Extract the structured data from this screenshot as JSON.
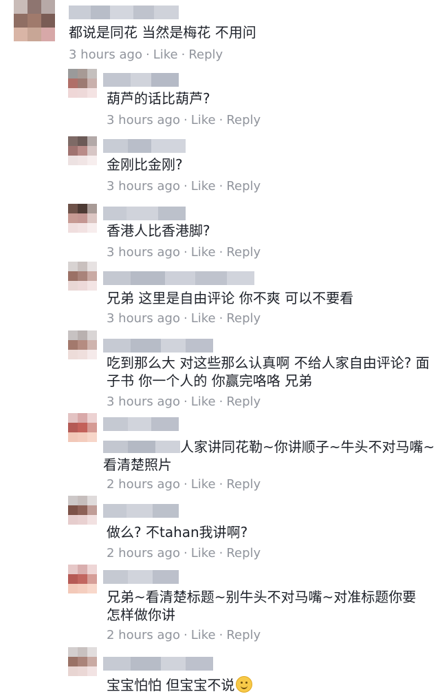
{
  "comments": [
    {
      "text": "都说是同花 当然是梅花 不用问",
      "time": "3 hours ago",
      "like": "Like",
      "reply": "Reply"
    },
    {
      "text": "葫芦的话比葫芦?",
      "time": "3 hours ago",
      "like": "Like",
      "reply": "Reply"
    },
    {
      "text": "金刚比金刚?",
      "time": "3 hours ago",
      "like": "Like",
      "reply": "Reply"
    },
    {
      "text": "香港人比香港脚?",
      "time": "3 hours ago",
      "like": "Like",
      "reply": "Reply"
    },
    {
      "text": "兄弟 这里是自由评论 你不爽 可以不要看",
      "time": "3 hours ago",
      "like": "Like",
      "reply": "Reply"
    },
    {
      "text": "吃到那么大 对这些那么认真啊 不给人家自由评论? 面子书 你一个人的 你赢完咯咯 兄弟",
      "time": "3 hours ago",
      "like": "Like",
      "reply": "Reply"
    },
    {
      "text": "人家讲同花勒~你讲顺子~牛头不对马嘴~看清楚照片",
      "time": "2 hours ago",
      "like": "Like",
      "reply": "Reply"
    },
    {
      "text": "做么? 不tahan我讲啊?",
      "time": "2 hours ago",
      "like": "Like",
      "reply": "Reply"
    },
    {
      "text": "兄弟~看清楚标题~别牛头不对马嘴~对准标题你要怎样做你讲",
      "time": "2 hours ago",
      "like": "Like",
      "reply": "Reply"
    },
    {
      "text": "宝宝怕怕 但宝宝不说",
      "time": "",
      "like": "",
      "reply": ""
    }
  ],
  "colors": {
    "meta": "#90949c",
    "text": "#1d2129",
    "emoji": "#f7c948"
  },
  "icons": {
    "emoji": "smiling-face-emoji-icon"
  }
}
